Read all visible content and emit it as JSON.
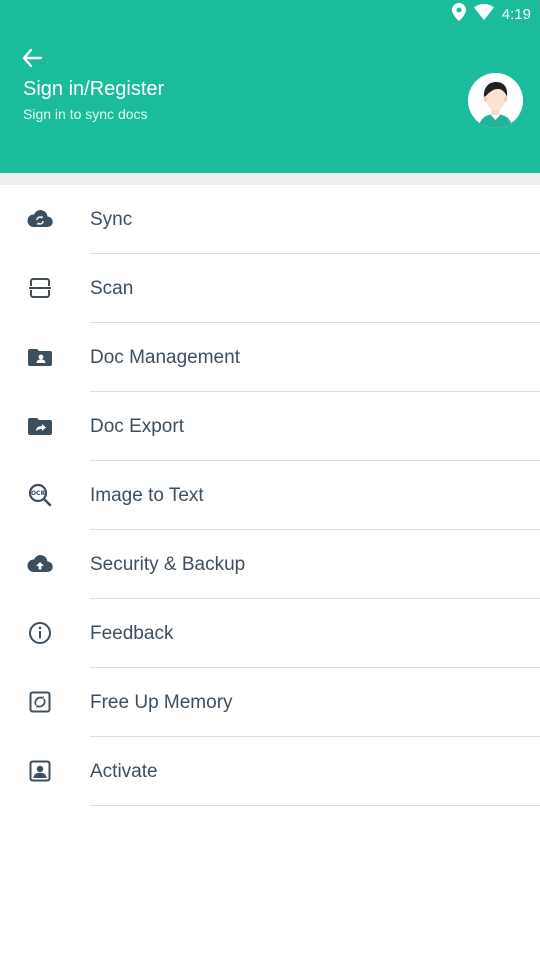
{
  "status_bar": {
    "time": "4:19",
    "icons": [
      "location-icon",
      "wifi-icon"
    ]
  },
  "header": {
    "title": "Sign in/Register",
    "subtitle": "Sign in to sync docs",
    "background_color": "#1abc9c",
    "back_icon": "arrow-left-icon",
    "avatar_icon": "user-avatar-icon"
  },
  "menu": {
    "items": [
      {
        "label": "Sync",
        "icon": "cloud-sync-icon"
      },
      {
        "label": "Scan",
        "icon": "scan-icon"
      },
      {
        "label": "Doc Management",
        "icon": "folder-person-icon"
      },
      {
        "label": "Doc Export",
        "icon": "folder-share-icon"
      },
      {
        "label": "Image to Text",
        "icon": "ocr-icon"
      },
      {
        "label": "Security & Backup",
        "icon": "cloud-upload-icon"
      },
      {
        "label": "Feedback",
        "icon": "info-icon"
      },
      {
        "label": "Free Up Memory",
        "icon": "clean-icon"
      },
      {
        "label": "Activate",
        "icon": "person-box-icon"
      }
    ],
    "icon_color": "#3d4f5f",
    "text_color": "#3d4f5f"
  }
}
